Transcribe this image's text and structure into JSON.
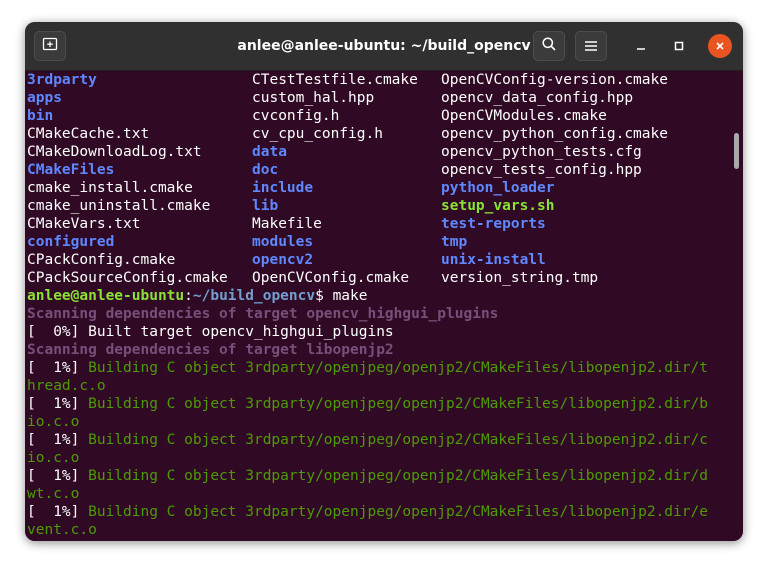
{
  "window": {
    "title": "anlee@anlee-ubuntu: ~/build_opencv",
    "colors": {
      "background": "#300a24",
      "titlebar": "#303030",
      "close": "#e95420"
    },
    "icons": [
      "new-tab-icon",
      "search-icon",
      "hamburger-menu-icon",
      "minimize-icon",
      "maximize-icon",
      "close-icon"
    ]
  },
  "terminal": {
    "ls_rows": [
      [
        {
          "text": "3rdparty",
          "kind": "dir"
        },
        {
          "text": "CTestTestfile.cmake",
          "kind": "file"
        },
        {
          "text": "OpenCVConfig-version.cmake",
          "kind": "file"
        }
      ],
      [
        {
          "text": "apps",
          "kind": "dir"
        },
        {
          "text": "custom_hal.hpp",
          "kind": "file"
        },
        {
          "text": "opencv_data_config.hpp",
          "kind": "file"
        }
      ],
      [
        {
          "text": "bin",
          "kind": "dir"
        },
        {
          "text": "cvconfig.h",
          "kind": "file"
        },
        {
          "text": "OpenCVModules.cmake",
          "kind": "file"
        }
      ],
      [
        {
          "text": "CMakeCache.txt",
          "kind": "file"
        },
        {
          "text": "cv_cpu_config.h",
          "kind": "file"
        },
        {
          "text": "opencv_python_config.cmake",
          "kind": "file"
        }
      ],
      [
        {
          "text": "CMakeDownloadLog.txt",
          "kind": "file"
        },
        {
          "text": "data",
          "kind": "dir"
        },
        {
          "text": "opencv_python_tests.cfg",
          "kind": "file"
        }
      ],
      [
        {
          "text": "CMakeFiles",
          "kind": "dir"
        },
        {
          "text": "doc",
          "kind": "dir"
        },
        {
          "text": "opencv_tests_config.hpp",
          "kind": "file"
        }
      ],
      [
        {
          "text": "cmake_install.cmake",
          "kind": "file"
        },
        {
          "text": "include",
          "kind": "dir"
        },
        {
          "text": "python_loader",
          "kind": "dir"
        }
      ],
      [
        {
          "text": "cmake_uninstall.cmake",
          "kind": "file"
        },
        {
          "text": "lib",
          "kind": "dir"
        },
        {
          "text": "setup_vars.sh",
          "kind": "exe"
        }
      ],
      [
        {
          "text": "CMakeVars.txt",
          "kind": "file"
        },
        {
          "text": "Makefile",
          "kind": "file"
        },
        {
          "text": "test-reports",
          "kind": "dir"
        }
      ],
      [
        {
          "text": "configured",
          "kind": "dir"
        },
        {
          "text": "modules",
          "kind": "dir"
        },
        {
          "text": "tmp",
          "kind": "dir"
        }
      ],
      [
        {
          "text": "CPackConfig.cmake",
          "kind": "file"
        },
        {
          "text": "opencv2",
          "kind": "dir"
        },
        {
          "text": "unix-install",
          "kind": "dir"
        }
      ],
      [
        {
          "text": "CPackSourceConfig.cmake",
          "kind": "file"
        },
        {
          "text": "OpenCVConfig.cmake",
          "kind": "file"
        },
        {
          "text": "version_string.tmp",
          "kind": "file"
        }
      ]
    ],
    "prompt": {
      "user_host": "anlee@anlee-ubuntu",
      "separator": ":",
      "path": "~/build_opencv",
      "symbol": "$ ",
      "command": "make"
    },
    "output_lines": [
      {
        "kind": "scan",
        "text": "Scanning dependencies of target opencv_highgui_plugins"
      },
      {
        "kind": "built",
        "prefix": "[  0%] ",
        "text": "Built target opencv_highgui_plugins"
      },
      {
        "kind": "scan",
        "text": "Scanning dependencies of target libopenjp2"
      },
      {
        "kind": "build",
        "prefix": "[  1%] ",
        "text": "Building C object 3rdparty/openjpeg/openjp2/CMakeFiles/libopenjp2.dir/t"
      },
      {
        "kind": "build",
        "prefix": "",
        "text": "hread.c.o"
      },
      {
        "kind": "build",
        "prefix": "[  1%] ",
        "text": "Building C object 3rdparty/openjpeg/openjp2/CMakeFiles/libopenjp2.dir/b"
      },
      {
        "kind": "build",
        "prefix": "",
        "text": "io.c.o"
      },
      {
        "kind": "build",
        "prefix": "[  1%] ",
        "text": "Building C object 3rdparty/openjpeg/openjp2/CMakeFiles/libopenjp2.dir/c"
      },
      {
        "kind": "build",
        "prefix": "",
        "text": "io.c.o"
      },
      {
        "kind": "build",
        "prefix": "[  1%] ",
        "text": "Building C object 3rdparty/openjpeg/openjp2/CMakeFiles/libopenjp2.dir/d"
      },
      {
        "kind": "build",
        "prefix": "",
        "text": "wt.c.o"
      },
      {
        "kind": "build",
        "prefix": "[  1%] ",
        "text": "Building C object 3rdparty/openjpeg/openjp2/CMakeFiles/libopenjp2.dir/e"
      },
      {
        "kind": "build",
        "prefix": "",
        "text": "vent.c.o"
      }
    ]
  }
}
